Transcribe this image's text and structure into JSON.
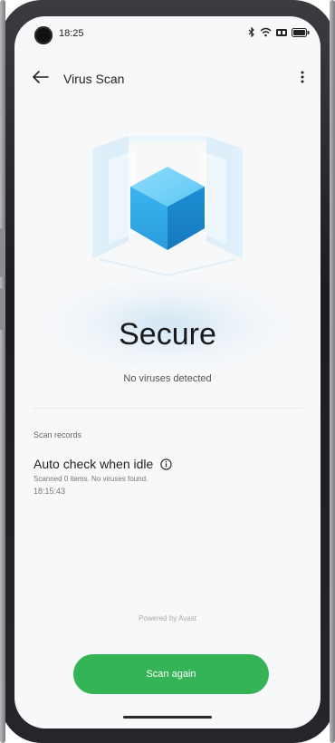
{
  "status_bar": {
    "time": "18:25",
    "icons": [
      "bluetooth-icon",
      "wifi-icon",
      "signal-icon",
      "battery-icon"
    ]
  },
  "header": {
    "back_icon": "arrow-left-icon",
    "title": "Virus Scan",
    "more_icon": "more-vertical-icon"
  },
  "result": {
    "title": "Secure",
    "subtitle": "No viruses detected"
  },
  "records": {
    "section_label": "Scan records",
    "items": [
      {
        "title": "Auto check when idle",
        "detail": "Scanned 0 items. No viruses found.",
        "time": "18:15:43"
      }
    ]
  },
  "footer": {
    "powered_by": "Powered by Avast",
    "scan_button": "Scan again"
  },
  "colors": {
    "accent_green": "#34b457",
    "cube_blue": "#3ab4ee"
  }
}
